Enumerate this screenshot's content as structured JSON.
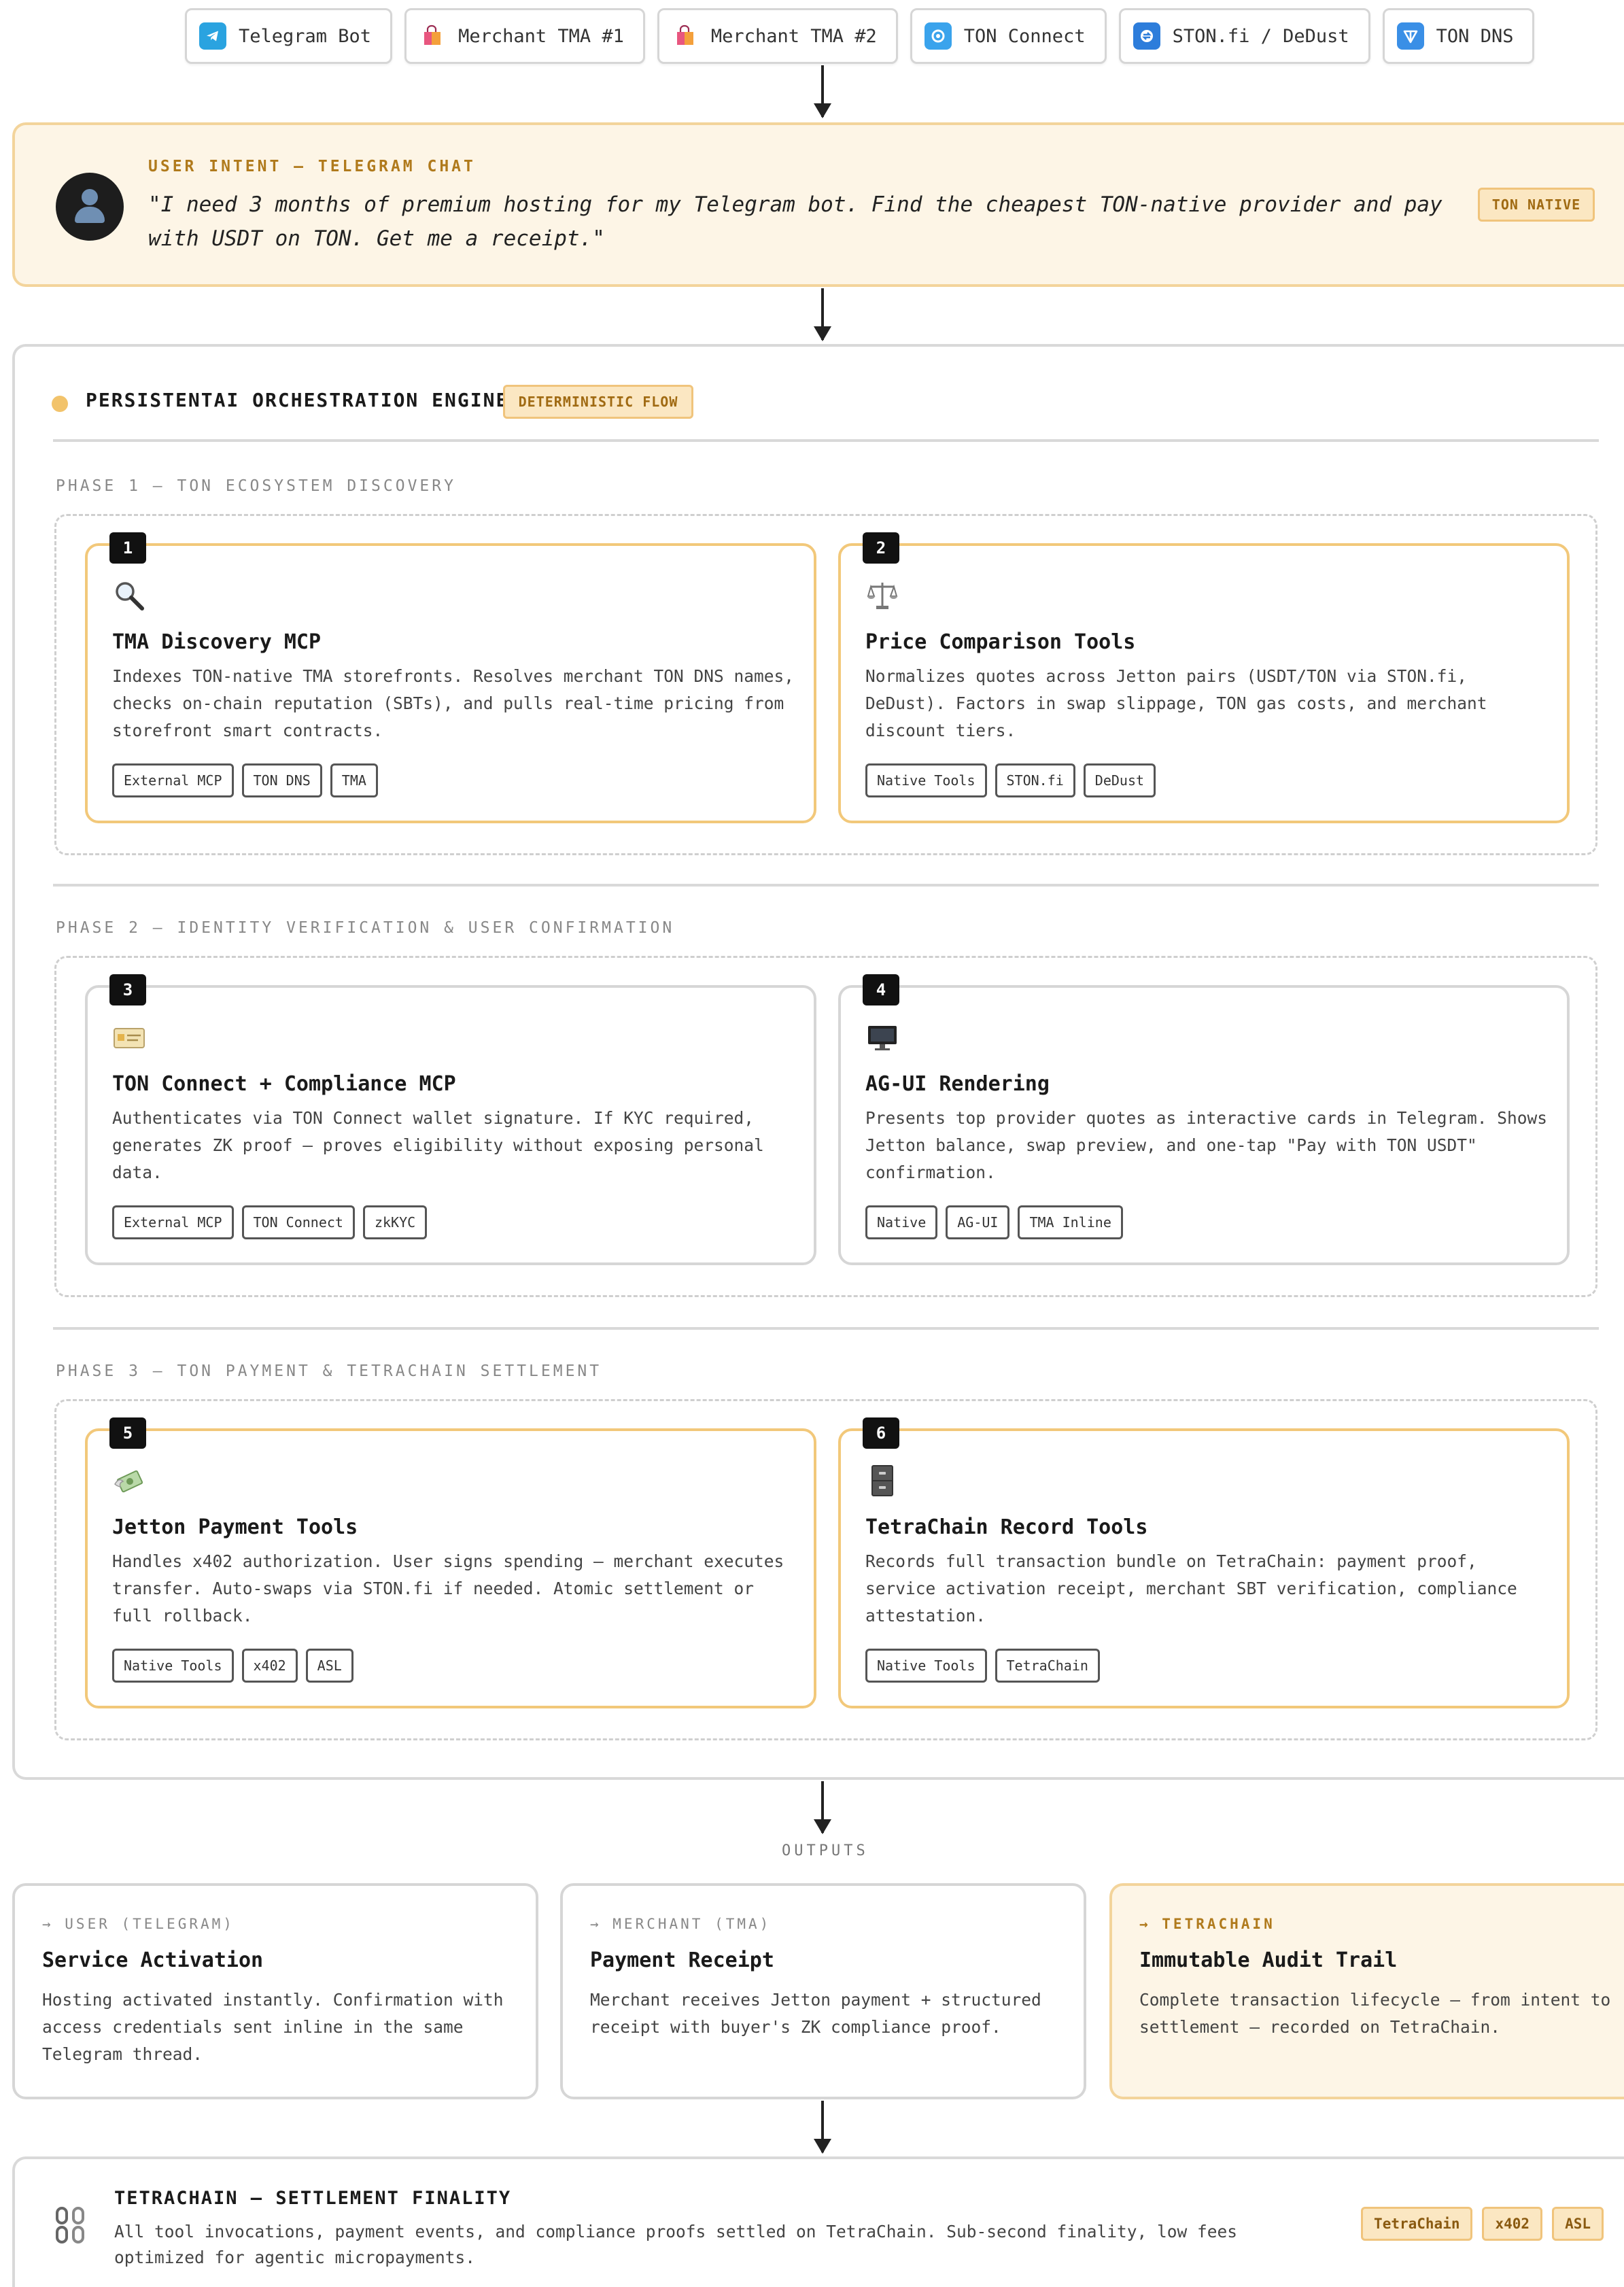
{
  "chips": [
    {
      "label": "Telegram Bot",
      "icon": "telegram-icon",
      "color": "#2aa3e0"
    },
    {
      "label": "Merchant TMA #1",
      "icon": "shopping-bag-icon",
      "color": "#e8567f"
    },
    {
      "label": "Merchant TMA #2",
      "icon": "shopping-bag-icon",
      "color": "#e8567f"
    },
    {
      "label": "TON Connect",
      "icon": "ton-connect-icon",
      "color": "#3aa3ec"
    },
    {
      "label": "STON.fi / DeDust",
      "icon": "swap-icon",
      "color": "#2d7ddb"
    },
    {
      "label": "TON DNS",
      "icon": "ton-diamond-icon",
      "color": "#3a8fe6"
    }
  ],
  "intent": {
    "label": "USER INTENT — TELEGRAM CHAT",
    "quote": "\"I need 3 months of premium hosting for my Telegram bot. Find the cheapest TON-native provider and pay with USDT on TON. Get me a receipt.\"",
    "badge": "TON NATIVE"
  },
  "engine": {
    "title": "PERSISTENTAI ORCHESTRATION ENGINE",
    "badge": "DETERMINISTIC FLOW"
  },
  "phases": [
    {
      "label": "PHASE 1 — TON ECOSYSTEM DISCOVERY",
      "cards": [
        {
          "num": "1",
          "icon": "magnifier-icon",
          "title": "TMA Discovery MCP",
          "desc": "Indexes TON-native TMA storefronts. Resolves merchant TON DNS names, checks on-chain reputation (SBTs), and pulls real-time pricing from storefront smart contracts.",
          "tags": [
            "External MCP",
            "TON DNS",
            "TMA"
          ]
        },
        {
          "num": "2",
          "icon": "scales-icon",
          "title": "Price Comparison Tools",
          "desc": "Normalizes quotes across Jetton pairs (USDT/TON via STON.fi, DeDust). Factors in swap slippage, TON gas costs, and merchant discount tiers.",
          "tags": [
            "Native Tools",
            "STON.fi",
            "DeDust"
          ]
        }
      ]
    },
    {
      "label": "PHASE 2 — IDENTITY VERIFICATION & USER CONFIRMATION",
      "cards": [
        {
          "num": "3",
          "icon": "id-card-icon",
          "title": "TON Connect + Compliance MCP",
          "desc": "Authenticates via TON Connect wallet signature. If KYC required, generates ZK proof — proves eligibility without exposing personal data.",
          "tags": [
            "External MCP",
            "TON Connect",
            "zkKYC"
          ]
        },
        {
          "num": "4",
          "icon": "monitor-icon",
          "title": "AG-UI Rendering",
          "desc": "Presents top provider quotes as interactive cards in Telegram. Shows Jetton balance, swap preview, and one-tap \"Pay with TON USDT\" confirmation.",
          "tags": [
            "Native",
            "AG-UI",
            "TMA Inline"
          ]
        }
      ]
    },
    {
      "label": "PHASE 3 — TON PAYMENT & TETRACHAIN SETTLEMENT",
      "cards": [
        {
          "num": "5",
          "icon": "money-wings-icon",
          "title": "Jetton Payment Tools",
          "desc": "Handles x402 authorization. User signs spending — merchant executes transfer. Auto-swaps via STON.fi if needed. Atomic settlement or full rollback.",
          "tags": [
            "Native Tools",
            "x402",
            "ASL"
          ]
        },
        {
          "num": "6",
          "icon": "file-cabinet-icon",
          "title": "TetraChain Record Tools",
          "desc": "Records full transaction bundle on TetraChain: payment proof, service activation receipt, merchant SBT verification, compliance attestation.",
          "tags": [
            "Native Tools",
            "TetraChain"
          ]
        }
      ]
    }
  ],
  "outputs": {
    "label": "OUTPUTS",
    "cards": [
      {
        "label": "→ USER (TELEGRAM)",
        "title": "Service Activation",
        "desc": "Hosting activated instantly. Confirmation with access credentials sent inline in the same Telegram thread."
      },
      {
        "label": "→ MERCHANT (TMA)",
        "title": "Payment Receipt",
        "desc": "Merchant receives Jetton payment + structured receipt with buyer's ZK compliance proof."
      },
      {
        "label": "→ TETRACHAIN",
        "title": "Immutable Audit Trail",
        "desc": "Complete transaction lifecycle — from intent to settlement — recorded on TetraChain."
      }
    ]
  },
  "settlement": {
    "icon": "chain-link-icon",
    "title": "TETRACHAIN  — SETTLEMENT FINALITY",
    "desc": "All tool invocations, payment events, and compliance proofs settled on TetraChain. Sub-second finality, low fees optimized for agentic micropayments.",
    "tags": [
      "TetraChain",
      "x402",
      "ASL"
    ]
  }
}
